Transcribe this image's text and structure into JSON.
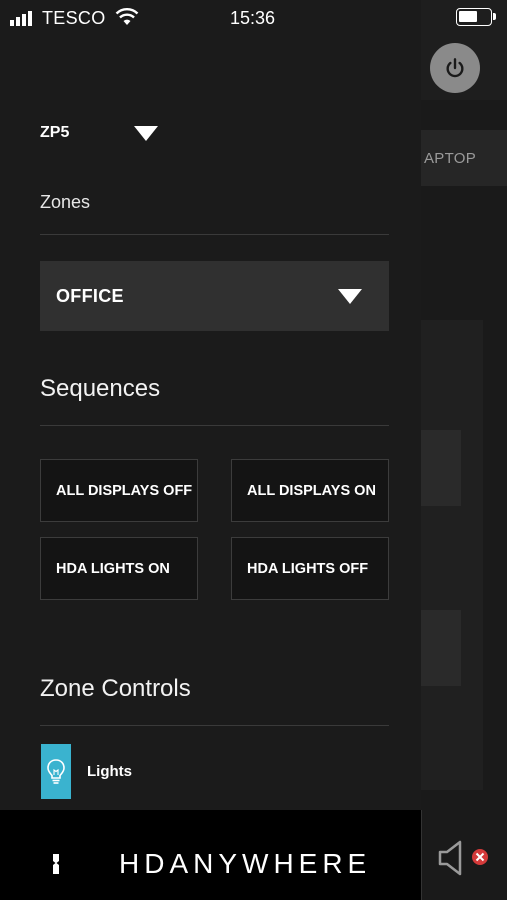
{
  "status_bar": {
    "carrier": "TESCO",
    "time": "15:36"
  },
  "background": {
    "tab_label": "APTOP",
    "power_icon": "power-icon",
    "mute_icon": "speaker-muted-icon"
  },
  "drawer": {
    "device": {
      "name": "ZP5",
      "icon": "triangle-down-icon"
    },
    "zones": {
      "label": "Zones",
      "selected": "OFFICE"
    },
    "sequences": {
      "title": "Sequences",
      "buttons": [
        "ALL DISPLAYS OFF",
        "ALL DISPLAYS ON",
        "HDA LIGHTS ON",
        "HDA LIGHTS OFF"
      ]
    },
    "zone_controls": {
      "title": "Zone Controls",
      "items": [
        {
          "label": "Lights",
          "icon": "lightbulb-icon",
          "icon_color": "#3ab3cf"
        }
      ]
    }
  },
  "footer": {
    "brand": "HDANYWHERE"
  },
  "colors": {
    "background": "#1b1b1b",
    "panel": "#303030",
    "accent": "#3ab3cf",
    "footer": "#000000"
  }
}
